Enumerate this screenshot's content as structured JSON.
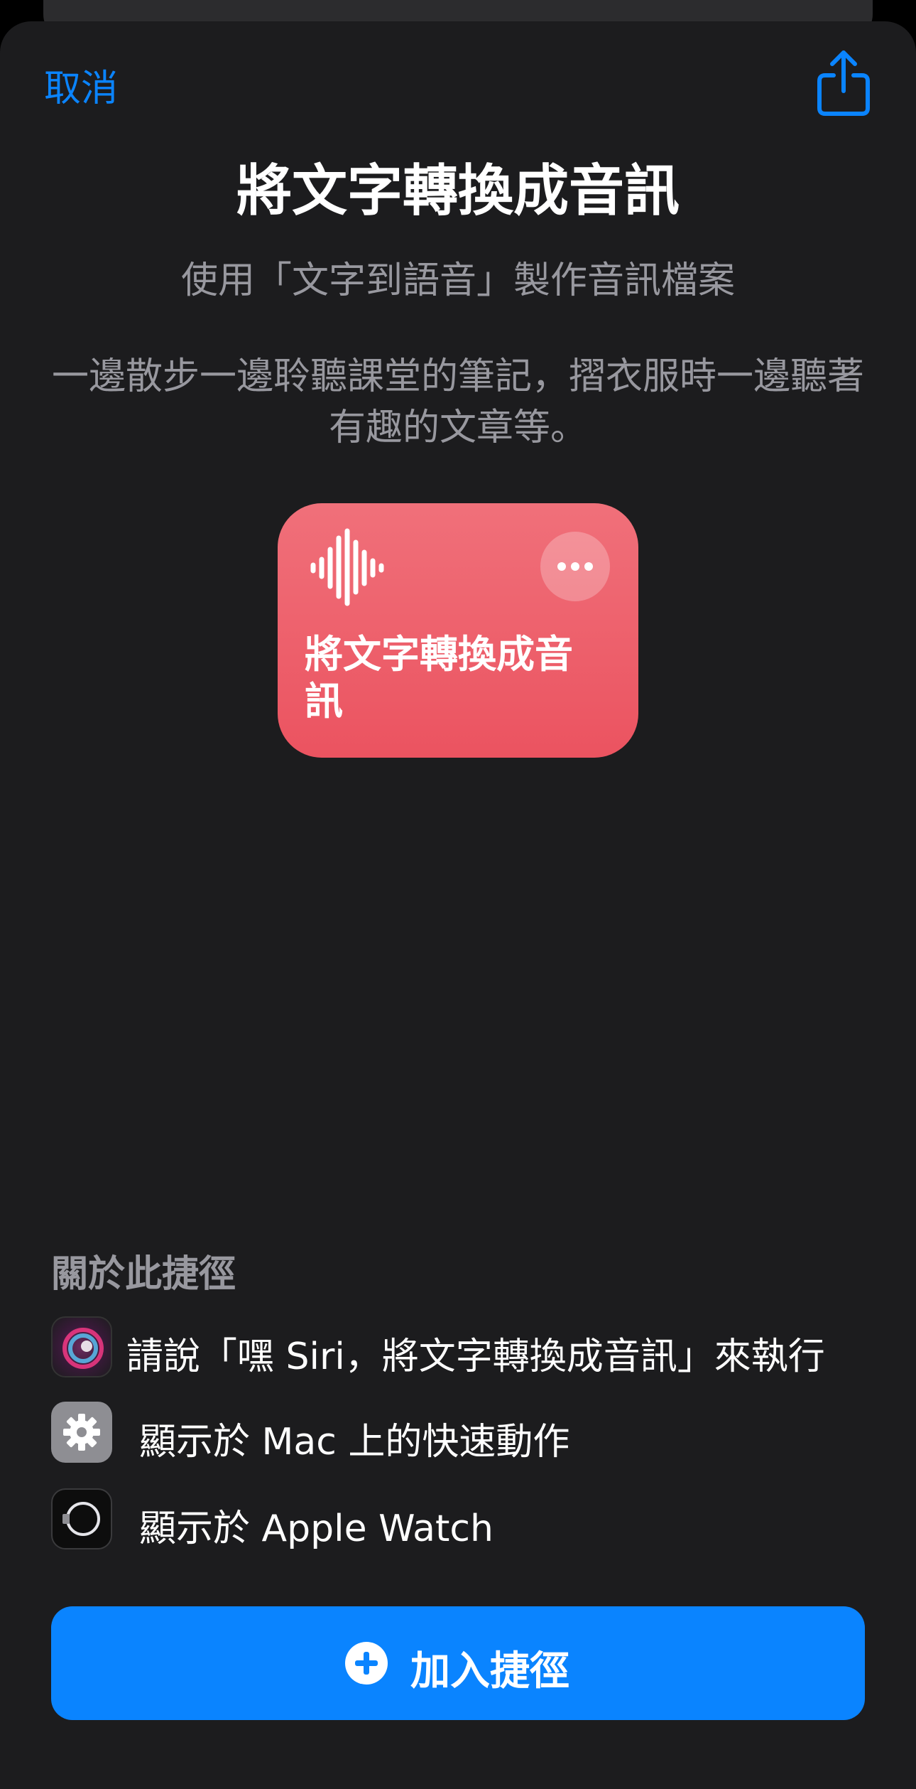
{
  "header": {
    "cancel_label": "取消"
  },
  "shortcut": {
    "title": "將文字轉換成音訊",
    "subtitle": "使用「文字到語音」製作音訊檔案",
    "description": "一邊散步一邊聆聽課堂的筆記，摺衣服時一邊聽著有趣的文章等。",
    "card_title": "將文字轉換成音訊",
    "card_color": "#eb5360"
  },
  "about": {
    "heading": "關於此捷徑",
    "items": [
      {
        "icon": "siri-icon",
        "text": "請說「嘿 Siri，將文字轉換成音訊」來執行"
      },
      {
        "icon": "gear-icon",
        "text": "顯示於 Mac 上的快速動作"
      },
      {
        "icon": "watch-icon",
        "text": "顯示於 Apple Watch"
      }
    ]
  },
  "footer": {
    "add_label": "加入捷徑",
    "accent": "#0a84ff"
  }
}
